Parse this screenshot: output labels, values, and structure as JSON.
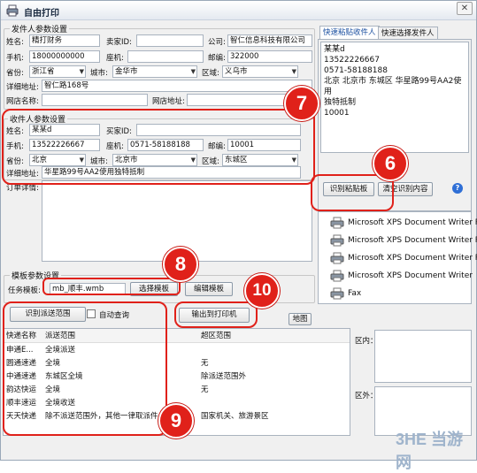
{
  "window": {
    "title": "自由打印",
    "close_glyph": "✕"
  },
  "sender": {
    "group_title": "发件人参数设置",
    "name_label": "姓名:",
    "name": "精打财务",
    "seller_id_label": "卖家ID:",
    "seller_id": "",
    "company_label": "公司:",
    "company": "智仁信息科技有限公司",
    "mobile_label": "手机:",
    "mobile": "18000000000",
    "phone_label": "座机:",
    "phone": "",
    "zip_label": "邮编:",
    "zip": "322000",
    "province_label": "省份:",
    "province": "浙江省",
    "city_label": "城市:",
    "city": "金华市",
    "district_label": "区域:",
    "district": "义乌市",
    "address_label": "详细地址:",
    "address": "智仁路168号",
    "shop_name_label": "网店名称:",
    "shop_name": "",
    "shop_url_label": "网店地址:",
    "shop_url": ""
  },
  "receiver": {
    "group_title": "收件人参数设置",
    "name_label": "姓名:",
    "name": "某某d",
    "buyer_id_label": "买家ID:",
    "buyer_id": "",
    "mobile_label": "手机:",
    "mobile": "13522226667",
    "phone_label": "座机:",
    "phone": "0571-58188188",
    "zip_label": "邮编:",
    "zip": "10001",
    "province_label": "省份:",
    "province": "北京",
    "city_label": "城市:",
    "city": "北京市",
    "district_label": "区域:",
    "district": "东城区",
    "address_label": "详细地址:",
    "address": "华星路99号AA2使用独特抵制"
  },
  "order": {
    "detail_label": "订单详情:"
  },
  "paste_panel": {
    "tabs": [
      "快速粘贴收件人",
      "快速选择发件人"
    ],
    "lines": [
      "某某d",
      "13522226667",
      "0571-58188188",
      "北京 北京市 东城区 华星路99号AA2使用",
      "独特抵制",
      "10001"
    ],
    "recognize_button": "识别粘贴板",
    "clear_button": "清空识别内容",
    "help_glyph": "?"
  },
  "printers": [
    "Microsoft XPS Document Writer P",
    "Microsoft XPS Document Writer P",
    "Microsoft XPS Document Writer P",
    "Microsoft XPS Document Writer",
    "Fax"
  ],
  "template": {
    "group_title": "模板参数设置",
    "label": "任务模板:",
    "value": "mb_顺丰.wmb",
    "select_button": "选择模板",
    "edit_button": "编辑模板"
  },
  "actions": {
    "recognize_range_button": "识别派送范围",
    "auto_query_label": "自动查询",
    "print_button": "输出到打印机",
    "map_button": "地图"
  },
  "delivery_table": {
    "headers": [
      "快递名称",
      "派送范围",
      "超区范围"
    ],
    "rows": [
      [
        "申通E...",
        "全境派送",
        ""
      ],
      [
        "圆通速递",
        "全境",
        "无"
      ],
      [
        "中通速递",
        "东城区全境",
        "除派送范围外"
      ],
      [
        "韵达快运",
        "全境",
        "无"
      ],
      [
        "顺丰速运",
        "全境收送",
        ""
      ],
      [
        "天天快递",
        "除不派送范围外，其他一律取派件.",
        "国家机关、旅游景区"
      ]
    ]
  },
  "side_labels": {
    "inside": "区内：",
    "outside": "区外："
  },
  "callouts": [
    "7",
    "6",
    "8",
    "10",
    "9"
  ],
  "watermark": "3HE 当游网"
}
